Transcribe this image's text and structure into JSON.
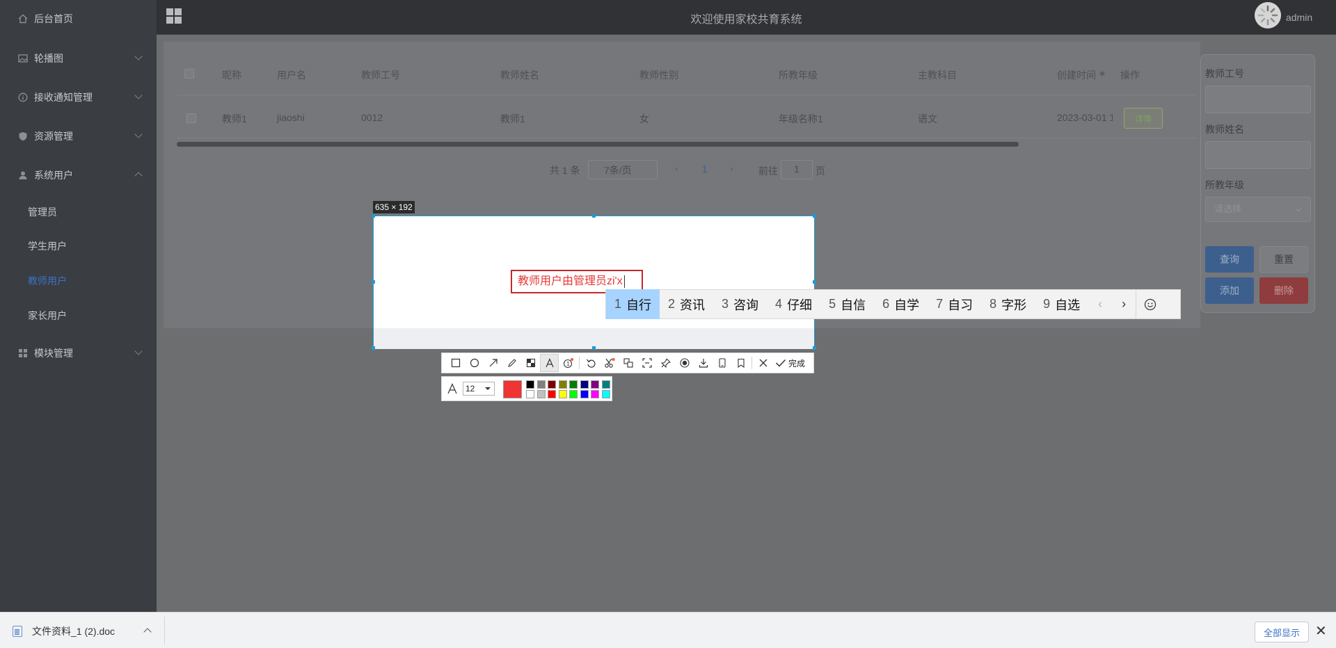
{
  "sidebar": {
    "items": [
      {
        "label": "后台首页",
        "icon": "home-icon"
      },
      {
        "label": "轮播图",
        "icon": "image-icon"
      },
      {
        "label": "接收通知管理",
        "icon": "info-icon"
      },
      {
        "label": "资源管理",
        "icon": "shield-icon"
      },
      {
        "label": "系统用户",
        "icon": "user-icon"
      },
      {
        "label": "模块管理",
        "icon": "grid-icon"
      }
    ],
    "sub_items": [
      "管理员",
      "学生用户",
      "教师用户",
      "家长用户"
    ],
    "active_sub": "教师用户"
  },
  "header": {
    "title": "欢迎使用家校共育系统",
    "username": "admin"
  },
  "table": {
    "columns": [
      "昵称",
      "用户名",
      "教师工号",
      "教师姓名",
      "教师性别",
      "所教年级",
      "主教科目",
      "创建时间",
      "操作"
    ],
    "rows": [
      {
        "nickname": "教师1",
        "username": "jiaoshi",
        "teacher_no": "0012",
        "teacher_name": "教师1",
        "gender": "女",
        "grade": "年级名称1",
        "subject": "语文",
        "created": "2023-03-01 1",
        "action": "详情"
      }
    ]
  },
  "pagination": {
    "total": "共 1 条",
    "page_size": "7条/页",
    "current_page": "1",
    "goto_label": "前往",
    "goto_value": "1",
    "page_suffix": "页"
  },
  "search": {
    "teacher_no_label": "教师工号",
    "teacher_name_label": "教师姓名",
    "grade_label": "所教年级",
    "grade_placeholder": "请选择",
    "query": "查询",
    "reset": "重置",
    "add": "添加",
    "delete": "删除"
  },
  "screenshot": {
    "size": "635 × 192",
    "text": "教师用户由管理员zi'x",
    "font_size": "12",
    "done": "完成",
    "current_color": "#f03333",
    "palette": [
      "#000000",
      "#808080",
      "#800000",
      "#808000",
      "#008000",
      "#000080",
      "#800080",
      "#008080",
      "#ffffff",
      "#c0c0c0",
      "#ff0000",
      "#ffff00",
      "#00ff00",
      "#0000ff",
      "#ff00ff",
      "#00ffff"
    ]
  },
  "ime": {
    "candidates": [
      {
        "num": "1",
        "text": "自行"
      },
      {
        "num": "2",
        "text": "资讯"
      },
      {
        "num": "3",
        "text": "咨询"
      },
      {
        "num": "4",
        "text": "仔细"
      },
      {
        "num": "5",
        "text": "自信"
      },
      {
        "num": "6",
        "text": "自学"
      },
      {
        "num": "7",
        "text": "自习"
      },
      {
        "num": "8",
        "text": "字形"
      },
      {
        "num": "9",
        "text": "自选"
      }
    ]
  },
  "download": {
    "file": "文件资料_1 (2).doc",
    "show_all": "全部显示"
  }
}
